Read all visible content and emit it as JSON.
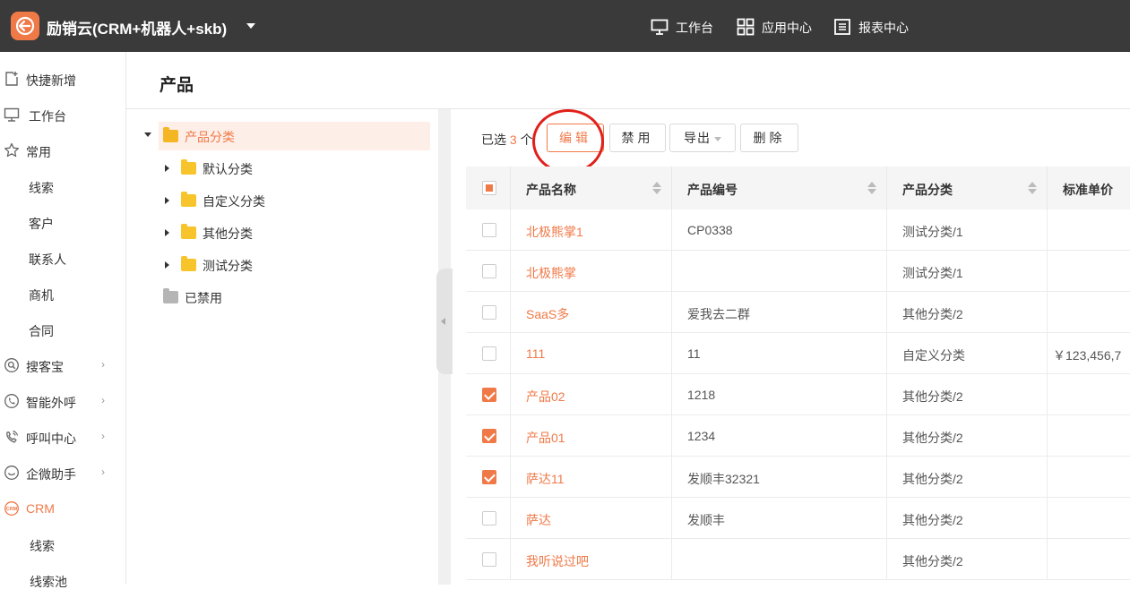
{
  "app": {
    "title": "励销云(CRM+机器人+skb)"
  },
  "topnav": [
    {
      "label": "工作台",
      "icon": "monitor-icon"
    },
    {
      "label": "应用中心",
      "icon": "grid-icon"
    },
    {
      "label": "报表中心",
      "icon": "report-icon"
    }
  ],
  "sidebar": {
    "items": [
      {
        "label": "快捷新增",
        "icon": "quick-add-icon"
      },
      {
        "label": "工作台",
        "icon": "monitor-icon"
      },
      {
        "label": "常用",
        "icon": "star-icon"
      },
      {
        "label": "线索"
      },
      {
        "label": "客户"
      },
      {
        "label": "联系人"
      },
      {
        "label": "商机"
      },
      {
        "label": "合同"
      },
      {
        "label": "搜客宝",
        "icon": "search-treasure-icon",
        "arrow": "›"
      },
      {
        "label": "智能外呼",
        "icon": "phone-icon",
        "arrow": "›"
      },
      {
        "label": "呼叫中心",
        "icon": "call-center-icon",
        "arrow": "›"
      },
      {
        "label": "企微助手",
        "icon": "wecom-icon",
        "arrow": "›"
      },
      {
        "label": "CRM",
        "icon": "crm-icon"
      },
      {
        "label": "线索"
      },
      {
        "label": "线索池"
      }
    ],
    "active_color": "#f07948"
  },
  "page": {
    "title": "产品"
  },
  "tree": {
    "root": "产品分类",
    "children": [
      "默认分类",
      "自定义分类",
      "其他分类",
      "测试分类"
    ],
    "disabled": "已禁用"
  },
  "toolbar": {
    "selected_prefix": "已选",
    "selected_count": "3",
    "selected_suffix": "个",
    "edit": "编辑",
    "disable": "禁用",
    "export": "导出",
    "delete": "删除"
  },
  "table": {
    "columns": [
      "产品名称",
      "产品编号",
      "产品分类",
      "标准单价"
    ],
    "rows": [
      {
        "checked": false,
        "name": "北极熊掌1",
        "code": "CP0338",
        "category": "测试分类/1",
        "price": ""
      },
      {
        "checked": false,
        "name": "北极熊掌",
        "code": "",
        "category": "测试分类/1",
        "price": ""
      },
      {
        "checked": false,
        "name": "SaaS多",
        "code": "爱我去二群",
        "category": "其他分类/2",
        "price": ""
      },
      {
        "checked": false,
        "name": "111",
        "code": "11",
        "category": "自定义分类",
        "price": "￥123,456,7"
      },
      {
        "checked": true,
        "name": "产品02",
        "code": "1218",
        "category": "其他分类/2",
        "price": ""
      },
      {
        "checked": true,
        "name": "产品01",
        "code": "1234",
        "category": "其他分类/2",
        "price": ""
      },
      {
        "checked": true,
        "name": "萨达11",
        "code": "发顺丰32321",
        "category": "其他分类/2",
        "price": ""
      },
      {
        "checked": false,
        "name": "萨达",
        "code": "发顺丰",
        "category": "其他分类/2",
        "price": ""
      },
      {
        "checked": false,
        "name": "我听说过吧",
        "code": "",
        "category": "其他分类/2",
        "price": ""
      }
    ]
  },
  "colors": {
    "accent": "#f07948",
    "topbar": "#3a3a3a",
    "highlight": "#e0201a"
  }
}
